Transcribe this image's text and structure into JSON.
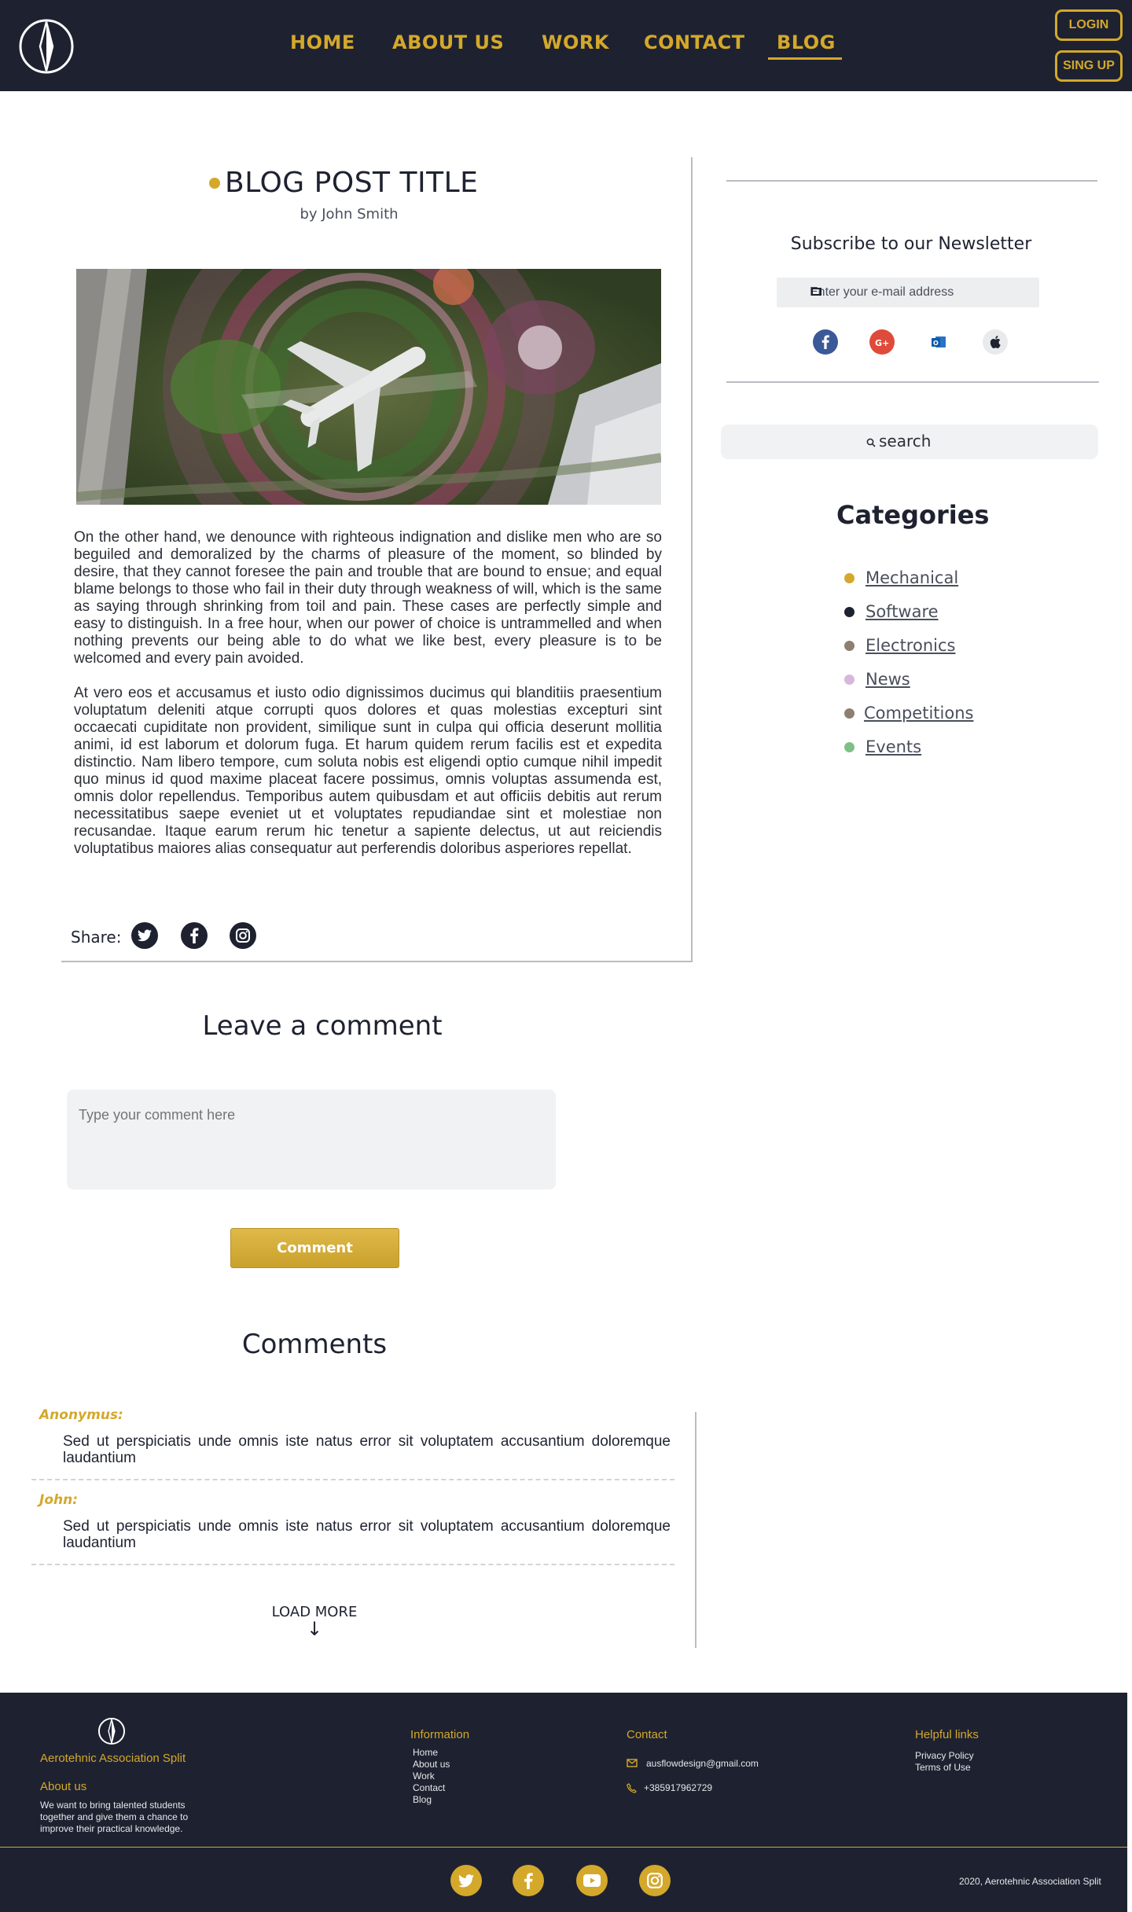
{
  "header": {
    "nav": [
      "HOME",
      "ABOUT US",
      "WORK",
      "CONTACT",
      "BLOG"
    ],
    "active_nav": "BLOG",
    "login_label": "LOGIN",
    "signup_label": "SING UP"
  },
  "post": {
    "title": "BLOG POST TITLE",
    "author": "by John Smith",
    "paragraphs": [
      "On the other hand, we denounce with righteous indignation and dislike men who are so beguiled and demoralized by the charms of pleasure of the moment, so blinded by desire, that they cannot foresee the pain and trouble that are bound to ensue; and equal blame belongs to those who fail in their duty through weakness of will, which is the same as saying through shrinking from toil and pain. These cases are perfectly simple and easy to distinguish. In a free hour, when our power of choice is untrammelled and when nothing prevents our being able to do what we like best, every pleasure is to be welcomed and every pain avoided.",
      "At vero eos et accusamus et iusto odio dignissimos ducimus qui blanditiis praesentium voluptatum deleniti atque corrupti quos dolores et quas molestias excepturi sint occaecati cupiditate non provident, similique sunt in culpa qui officia deserunt mollitia animi, id est laborum et dolorum fuga. Et harum quidem rerum facilis est et expedita distinctio. Nam libero tempore, cum soluta nobis est eligendi optio cumque nihil impedit quo minus id quod maxime placeat facere possimus, omnis voluptas assumenda est, omnis dolor repellendus. Temporibus autem quibusdam et aut officiis debitis aut rerum necessitatibus saepe eveniet ut et voluptates repudiandae sint et molestiae non recusandae. Itaque earum rerum hic tenetur a sapiente delectus, ut aut reiciendis voluptatibus maiores alias consequatur aut perferendis doloribus asperiores repellat."
    ],
    "share_label": "Share:",
    "share_icons": [
      "twitter-icon",
      "facebook-icon",
      "instagram-icon"
    ]
  },
  "comment_form": {
    "heading": "Leave a comment",
    "placeholder": "Type your comment here",
    "button_label": "Comment"
  },
  "comments": {
    "heading": "Comments",
    "items": [
      {
        "author": "Anonymus:",
        "text": "Sed ut perspiciatis unde omnis iste natus error sit voluptatem accusantium doloremque laudantium"
      },
      {
        "author": "John:",
        "text": "Sed ut perspiciatis unde omnis iste natus error sit voluptatem accusantium doloremque laudantium"
      }
    ],
    "load_more": "LOAD MORE",
    "load_more_arrow": "↓"
  },
  "sidebar": {
    "newsletter_title": "Subscribe to our Newsletter",
    "email_placeholder": "Enter your e-mail address",
    "signin_icons": [
      "facebook-icon",
      "google-plus-icon",
      "outlook-icon",
      "apple-icon"
    ],
    "search_label": "search",
    "categories_title": "Categories",
    "categories": [
      {
        "label": "Mechanical",
        "color": "#d4a82b"
      },
      {
        "label": "Software",
        "color": "#1e2230"
      },
      {
        "label": "Electronics",
        "color": "#8e8070"
      },
      {
        "label": "News",
        "color": "#d6b8dc"
      },
      {
        "label": "Competitions",
        "color": "#8e8070"
      },
      {
        "label": "Events",
        "color": "#7fbf86"
      }
    ]
  },
  "footer": {
    "org_name": "Aerotehnic Association Split",
    "about_title": "About us",
    "about_text": "We want to bring talented students together and give them a chance to improve their practical knowledge.",
    "information_title": "Information",
    "information_links": [
      "Home",
      "About us",
      "Work",
      "Contact",
      "Blog"
    ],
    "contact_title": "Contact",
    "email": "ausflowdesign@gmail.com",
    "phone": "+385917962729",
    "helpful_title": "Helpful links",
    "helpful_links": [
      "Privacy Policy",
      "Terms of Use"
    ],
    "social_icons": [
      "twitter-icon",
      "facebook-icon",
      "youtube-icon",
      "instagram-icon"
    ],
    "copyright": "2020, Aerotehnic Association Split"
  },
  "colors": {
    "navy": "#1e2230",
    "gold": "#d4a82b"
  }
}
